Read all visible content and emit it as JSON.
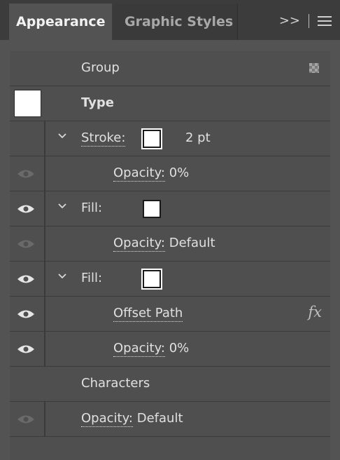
{
  "tabs": {
    "appearance": "Appearance",
    "graphic_styles": "Graphic Styles"
  },
  "menu": {
    "overflow": ">>"
  },
  "rows": {
    "group": "Group",
    "type": "Type",
    "stroke_label": "Stroke:",
    "stroke_value": "2 pt",
    "opacity_label": "Opacity:",
    "stroke_opacity_value": "0%",
    "fill_label": "Fill:",
    "fill1_opacity_value": "Default",
    "offset_path": "Offset Path",
    "fx": "fx",
    "fill2_opacity_value": "0%",
    "characters": "Characters",
    "characters_opacity_value": "Default"
  },
  "colors": {
    "panel_bg": "#535353",
    "swatch": "#ffffff",
    "tab_bar": "#3c3c3c"
  },
  "icons": [
    "eye-icon",
    "chevron-down-icon",
    "fx-icon",
    "checkerboard-icon",
    "hamburger-menu-icon"
  ]
}
